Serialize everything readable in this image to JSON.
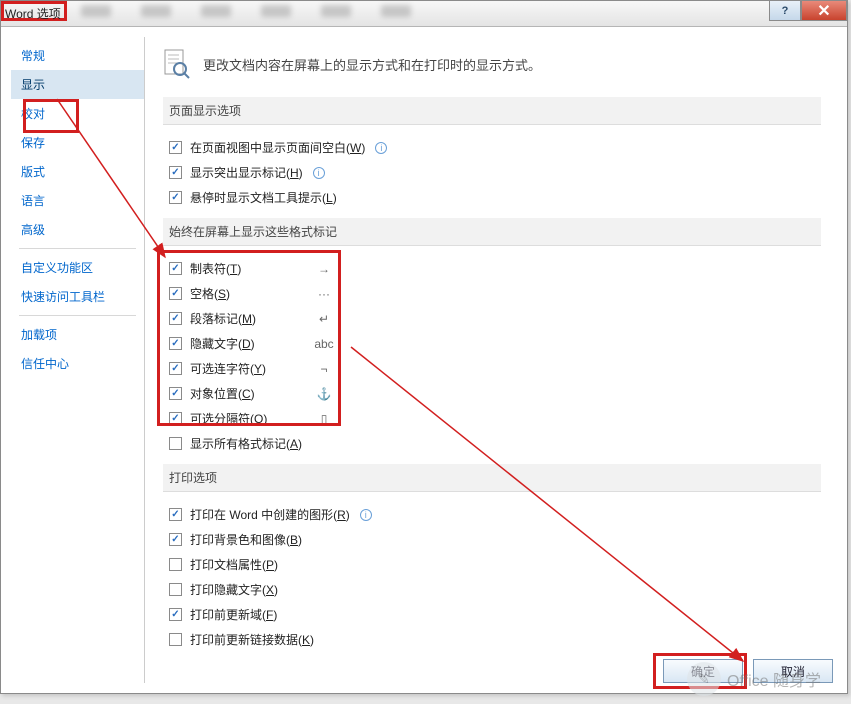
{
  "window": {
    "title": "Word 选项",
    "help_btn": "?",
    "close_btn": "✕"
  },
  "sidebar": {
    "items": [
      {
        "label": "常规"
      },
      {
        "label": "显示",
        "selected": true
      },
      {
        "label": "校对"
      },
      {
        "label": "保存"
      },
      {
        "label": "版式"
      },
      {
        "label": "语言"
      },
      {
        "label": "高级"
      }
    ],
    "items2": [
      {
        "label": "自定义功能区"
      },
      {
        "label": "快速访问工具栏"
      }
    ],
    "items3": [
      {
        "label": "加载项"
      },
      {
        "label": "信任中心"
      }
    ]
  },
  "intro": {
    "text": "更改文档内容在屏幕上的显示方式和在打印时的显示方式。"
  },
  "sections": {
    "page_display": {
      "header": "页面显示选项",
      "opts": [
        {
          "checked": true,
          "label_pre": "在页面视图中显示页面间空白(",
          "hot": "W",
          "label_post": ")",
          "info": true
        },
        {
          "checked": true,
          "label_pre": "显示突出显示标记(",
          "hot": "H",
          "label_post": ")",
          "info": true
        },
        {
          "checked": true,
          "label_pre": "悬停时显示文档工具提示(",
          "hot": "L",
          "label_post": ")"
        }
      ]
    },
    "format_marks": {
      "header": "始终在屏幕上显示这些格式标记",
      "opts": [
        {
          "checked": true,
          "label_pre": "制表符(",
          "hot": "T",
          "label_post": ")",
          "sym": "→"
        },
        {
          "checked": true,
          "label_pre": "空格(",
          "hot": "S",
          "label_post": ")",
          "sym": "···"
        },
        {
          "checked": true,
          "label_pre": "段落标记(",
          "hot": "M",
          "label_post": ")",
          "sym": "↵"
        },
        {
          "checked": true,
          "label_pre": "隐藏文字(",
          "hot": "D",
          "label_post": ")",
          "sym": "abc"
        },
        {
          "checked": true,
          "label_pre": "可选连字符(",
          "hot": "Y",
          "label_post": ")",
          "sym": "¬"
        },
        {
          "checked": true,
          "label_pre": "对象位置(",
          "hot": "C",
          "label_post": ")",
          "sym": "⚓"
        },
        {
          "checked": true,
          "label_pre": "可选分隔符(",
          "hot": "O",
          "label_post": ")",
          "sym": "▯"
        }
      ],
      "extra": {
        "checked": false,
        "label_pre": "显示所有格式标记(",
        "hot": "A",
        "label_post": ")"
      }
    },
    "print": {
      "header": "打印选项",
      "opts": [
        {
          "checked": true,
          "label_pre": "打印在 Word 中创建的图形(",
          "hot": "R",
          "label_post": ")",
          "info": true
        },
        {
          "checked": true,
          "label_pre": "打印背景色和图像(",
          "hot": "B",
          "label_post": ")"
        },
        {
          "checked": false,
          "label_pre": "打印文档属性(",
          "hot": "P",
          "label_post": ")"
        },
        {
          "checked": false,
          "label_pre": "打印隐藏文字(",
          "hot": "X",
          "label_post": ")"
        },
        {
          "checked": true,
          "label_pre": "打印前更新域(",
          "hot": "F",
          "label_post": ")"
        },
        {
          "checked": false,
          "label_pre": "打印前更新链接数据(",
          "hot": "K",
          "label_post": ")"
        }
      ]
    }
  },
  "buttons": {
    "ok": "确定",
    "cancel": "取消"
  },
  "watermark": "Office 随身学"
}
